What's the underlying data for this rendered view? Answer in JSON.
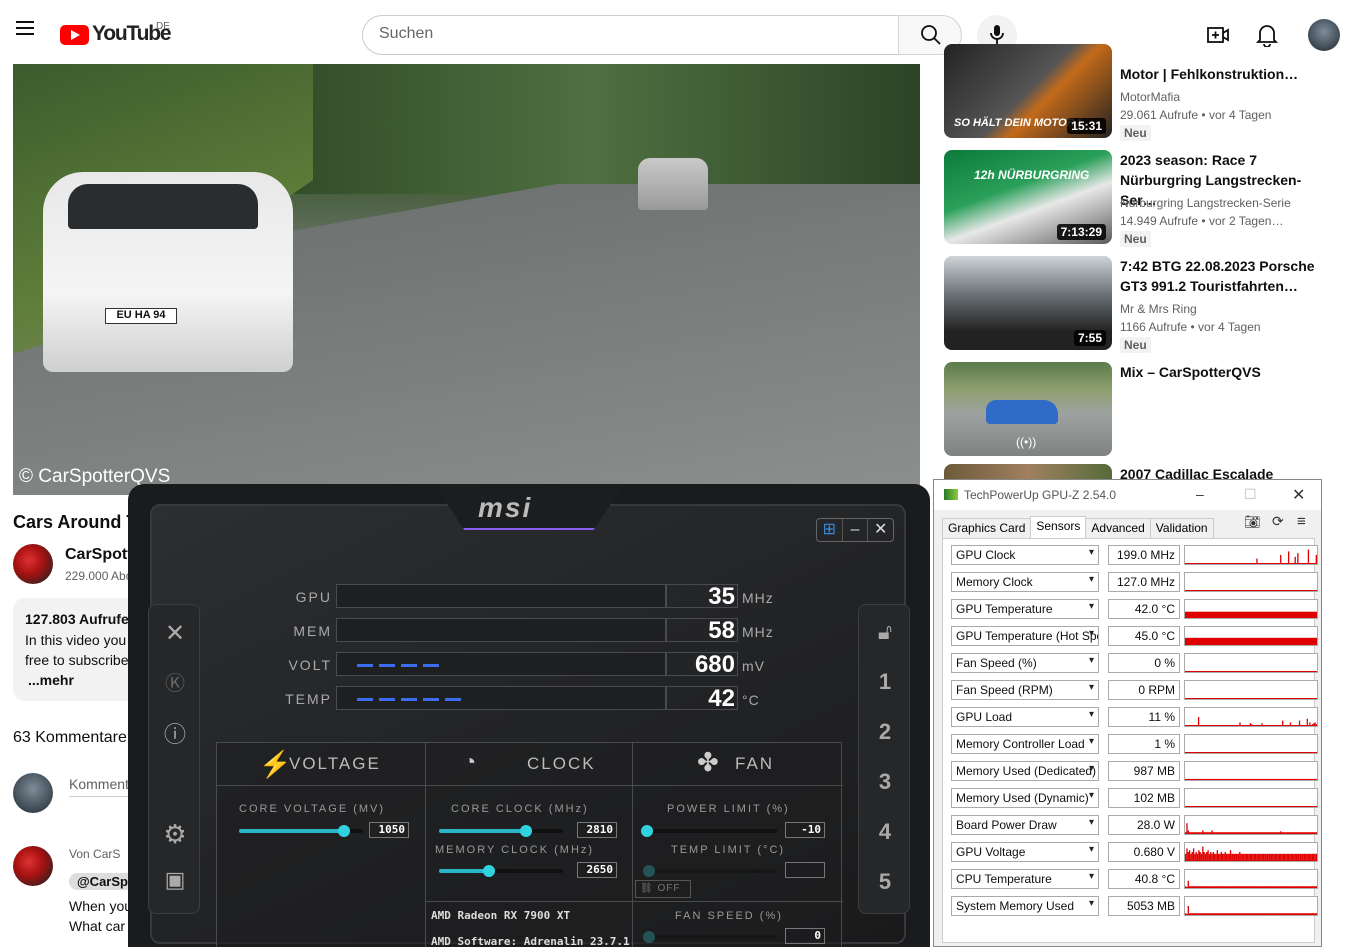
{
  "youtube": {
    "logo_text": "YouTube",
    "country": "DE",
    "search_placeholder": "Suchen",
    "video": {
      "watermark": "© CarSpotterQVS",
      "plate": "EU HA 94",
      "title": "Cars Around T",
      "channel_name": "CarSpott",
      "subscribers": "229.000 Abo",
      "views": "127.803 Aufrufe",
      "desc_line1": "In this video you",
      "desc_line2": "free to subscribe",
      "more": "...mehr",
      "comments_count": "63 Kommentare",
      "comment_placeholder": "Komment",
      "pinned_by": "Von CarS",
      "pinned_handle": "@CarSpo",
      "comment_line1": "When you",
      "comment_line2": "What car"
    },
    "related": [
      {
        "title": "Motor | Fehlkonstruktion…",
        "channel": "MotorMafia",
        "views": "29.061 Aufrufe",
        "age": "vor 4 Tagen",
        "badge": "Neu",
        "duration": "15:31",
        "thumb_text": "SO HÄLT DEIN MOTOR L"
      },
      {
        "title_l1": "2023 season: Race 7",
        "title_l2": "Nürburgring Langstrecken-Ser…",
        "channel": "Nürburgring Langstrecken-Serie",
        "views": "14.949 Aufrufe",
        "age": "vor 2 Tagen…",
        "badge": "Neu",
        "duration": "7:13:29",
        "thumb_text": "12h NÜRBURGRING"
      },
      {
        "title_l1": "7:42 BTG 22.08.2023 Porsche",
        "title_l2": "GT3 991.2 Touristfahrten…",
        "channel": "Mr & Mrs Ring",
        "views": "1166 Aufrufe",
        "age": "vor 4 Tagen",
        "badge": "Neu",
        "duration": "7:55"
      },
      {
        "title": "Mix – CarSpotterQVS"
      },
      {
        "title": "2007 Cadillac Escalade"
      }
    ]
  },
  "msi": {
    "logo": "msi",
    "meters": [
      {
        "label": "GPU",
        "value": "35",
        "unit": "MHz",
        "fill": 0.0
      },
      {
        "label": "MEM",
        "value": "58",
        "unit": "MHz",
        "fill": 0.0
      },
      {
        "label": "VOLT",
        "value": "680",
        "unit": "mV",
        "fill": 0.28
      },
      {
        "label": "TEMP",
        "value": "42",
        "unit": "°C",
        "fill": 0.36
      }
    ],
    "side_left_icons": [
      "msi-dragon-icon",
      "k-boost-icon",
      "info-icon",
      "settings-icon",
      "monitor-icon"
    ],
    "side_right": [
      "lock-icon",
      "1",
      "2",
      "3",
      "4",
      "5"
    ],
    "voltage": {
      "title": "VOLTAGE",
      "core_label": "CORE VOLTAGE  (MV)",
      "core_value": "1050",
      "core_level": 0.85
    },
    "clock": {
      "title": "CLOCK",
      "core_label": "CORE CLOCK (MHz)",
      "core_value": "2810",
      "core_level": 0.7,
      "mem_label": "MEMORY CLOCK (MHz)",
      "mem_value": "2650",
      "mem_level": 0.4
    },
    "fan": {
      "title": "FAN",
      "power_label": "POWER LIMIT (%)",
      "power_value": "-10",
      "power_level": 0.0,
      "temp_label": "TEMP LIMIT (°C)",
      "temp_value": "",
      "off_label": "OFF",
      "speed_label": "FAN SPEED (%)",
      "speed_value": "0"
    },
    "gpu_name": "AMD Radeon RX 7900 XT",
    "driver": "AMD Software: Adrenalin 23.7.1"
  },
  "gpuz": {
    "title": "TechPowerUp GPU-Z 2.54.0",
    "tabs": [
      "Graphics Card",
      "Sensors",
      "Advanced",
      "Validation"
    ],
    "active_tab": "Sensors",
    "sensors": [
      {
        "name": "GPU Clock",
        "value": "199.0 MHz"
      },
      {
        "name": "Memory Clock",
        "value": "127.0 MHz"
      },
      {
        "name": "GPU Temperature",
        "value": "42.0 °C"
      },
      {
        "name": "GPU Temperature (Hot Spot)",
        "value": "45.0 °C"
      },
      {
        "name": "Fan Speed (%)",
        "value": "0 %"
      },
      {
        "name": "Fan Speed (RPM)",
        "value": "0 RPM"
      },
      {
        "name": "GPU Load",
        "value": "11 %"
      },
      {
        "name": "Memory Controller Load",
        "value": "1 %"
      },
      {
        "name": "Memory Used (Dedicated)",
        "value": "987 MB"
      },
      {
        "name": "Memory Used (Dynamic)",
        "value": "102 MB"
      },
      {
        "name": "Board Power Draw",
        "value": "28.0 W"
      },
      {
        "name": "GPU Voltage",
        "value": "0.680 V"
      },
      {
        "name": "CPU Temperature",
        "value": "40.8 °C"
      },
      {
        "name": "System Memory Used",
        "value": "5053 MB"
      }
    ],
    "graph_color": "#e00000"
  }
}
